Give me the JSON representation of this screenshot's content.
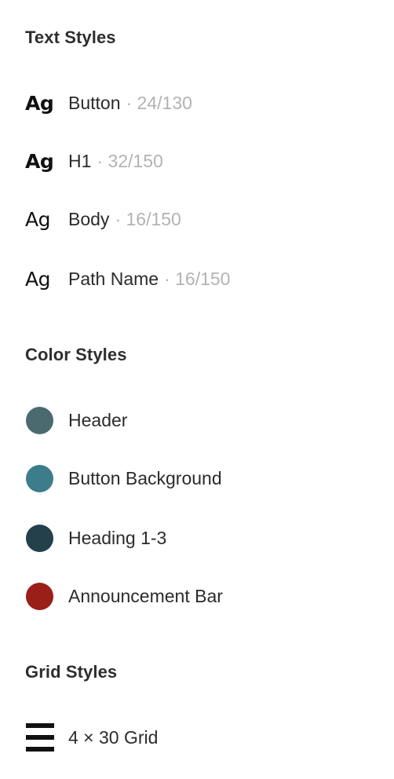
{
  "text_styles": {
    "title": "Text Styles",
    "items": [
      {
        "glyph": "Ag",
        "name": "Button",
        "meta": "· 24/130"
      },
      {
        "glyph": "Ag",
        "name": "H1",
        "meta": "· 32/150"
      },
      {
        "glyph": "Ag",
        "name": "Body",
        "meta": "· 16/150"
      },
      {
        "glyph": "Ag",
        "name": "Path Name",
        "meta": "· 16/150"
      }
    ]
  },
  "color_styles": {
    "title": "Color Styles",
    "items": [
      {
        "name": "Header",
        "color": "#4a6a70"
      },
      {
        "name": "Button Background",
        "color": "#3d7c8b"
      },
      {
        "name": "Heading 1-3",
        "color": "#23404b"
      },
      {
        "name": "Announcement Bar",
        "color": "#9a1f19"
      }
    ]
  },
  "grid_styles": {
    "title": "Grid Styles",
    "items": [
      {
        "icon": "grid-rows-icon",
        "name": "4 × 30 Grid"
      }
    ]
  }
}
